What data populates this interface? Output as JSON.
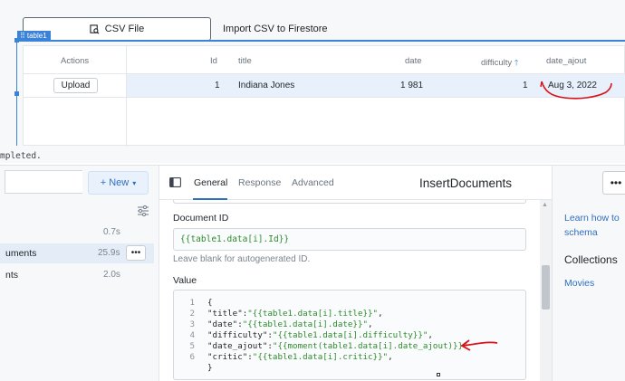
{
  "canvas": {
    "csv_button_label": "CSV File",
    "import_label": "Import CSV to Firestore",
    "table_tag": "table1"
  },
  "table": {
    "columns": [
      "Actions",
      "Id",
      "title",
      "date",
      "difficulty",
      "date_ajout"
    ],
    "rows": [
      {
        "action": "Upload",
        "id": "1",
        "title": "Indiana Jones",
        "date": "1 981",
        "difficulty": "1",
        "date_ajout": "Aug 3, 2022"
      }
    ]
  },
  "status_text": "mpleted.",
  "query_list": {
    "new_button": "+ New",
    "items": [
      {
        "name": "",
        "time": "0.7s"
      },
      {
        "name": "uments",
        "time": "25.9s",
        "more": "•••"
      },
      {
        "name": "nts",
        "time": "2.0s"
      }
    ]
  },
  "editor": {
    "tabs": [
      "General",
      "Response",
      "Advanced"
    ],
    "query_name": "InsertDocuments",
    "document_id_label": "Document ID",
    "document_id_value": "{{table1.data[i].Id}}",
    "document_id_hint": "Leave blank for autogenerated ID.",
    "value_label": "Value",
    "code_lines": [
      {
        "n": "1",
        "key": "{",
        "val": ""
      },
      {
        "n": "2",
        "key": "\"title\":",
        "val": "\"{{table1.data[i].title}}\"",
        "tail": ","
      },
      {
        "n": "3",
        "key": "\"date\":",
        "val": "\"{{table1.data[i].date}}\"",
        "tail": ","
      },
      {
        "n": "4",
        "key": "\"difficulty\":",
        "val": "\"{{table1.data[i].difficulty}}\"",
        "tail": ","
      },
      {
        "n": "5",
        "key": "\"date_ajout\":",
        "val": "\"{{moment(table1.data[i].date_ajout)}}\"",
        "tail": ""
      },
      {
        "n": "6",
        "key": "\"critic\":",
        "val": "\"{{table1.data[i].critic}}\"",
        "tail": ","
      }
    ]
  },
  "right_panel": {
    "more_button": "•••",
    "link_line1": "Learn how to",
    "link_line2": "schema",
    "heading": "Collections",
    "item": "Movies"
  },
  "colors": {
    "accent": "#3b82d9",
    "code_green": "#2e8b2e",
    "annotation_red": "#d8111b",
    "row_highlight": "#e8f1fb"
  }
}
